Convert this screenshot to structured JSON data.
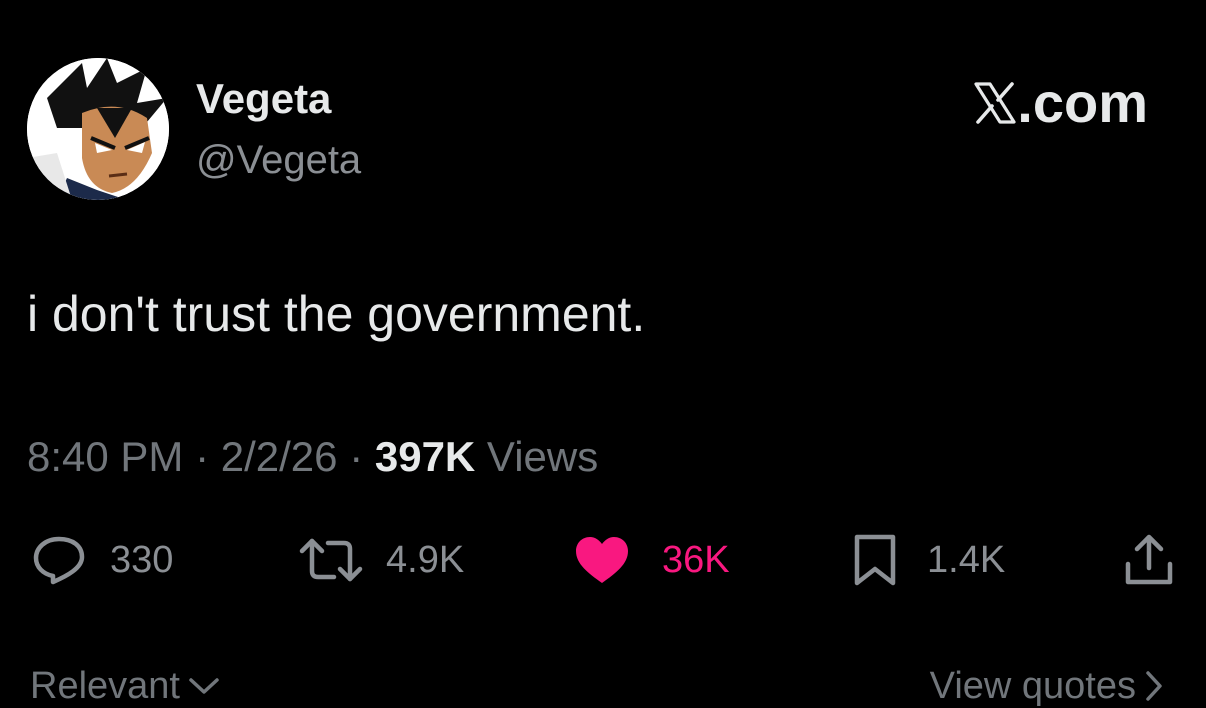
{
  "author": {
    "display_name": "Vegeta",
    "handle": "@Vegeta",
    "avatar_icon": "vegeta-avatar"
  },
  "brand": {
    "text": ".com",
    "icon": "x-logo-icon"
  },
  "tweet": {
    "text": "i don't trust the government."
  },
  "meta": {
    "time": "8:40 PM",
    "separator1": " · ",
    "date": "2/2/26",
    "separator2": " · ",
    "views_count": "397K",
    "views_label": " Views"
  },
  "actions": {
    "replies": "330",
    "reposts": "4.9K",
    "likes": "36K",
    "bookmarks": "1.4K"
  },
  "footer": {
    "sort_label": "Relevant",
    "quotes_label": "View quotes"
  },
  "colors": {
    "background": "#000000",
    "primary_text": "#e7e9ea",
    "secondary_text": "#71767b",
    "like_pink": "#f91880"
  }
}
